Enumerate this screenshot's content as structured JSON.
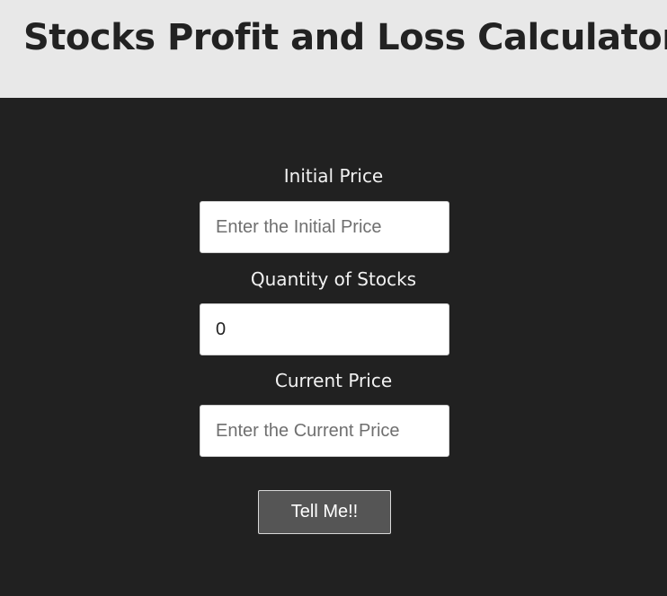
{
  "header": {
    "title": "Stocks Profit and Loss Calculator"
  },
  "form": {
    "initial_price": {
      "label": "Initial Price",
      "value": "",
      "placeholder": "Enter the Initial Price"
    },
    "quantity": {
      "label": "Quantity of Stocks",
      "value": "0",
      "placeholder": ""
    },
    "current_price": {
      "label": "Current Price",
      "value": "",
      "placeholder": "Enter the Current Price"
    },
    "submit_label": "Tell Me!!"
  },
  "colors": {
    "header_bg": "#e8e8e8",
    "page_bg": "#212121",
    "button_bg": "#555555"
  }
}
